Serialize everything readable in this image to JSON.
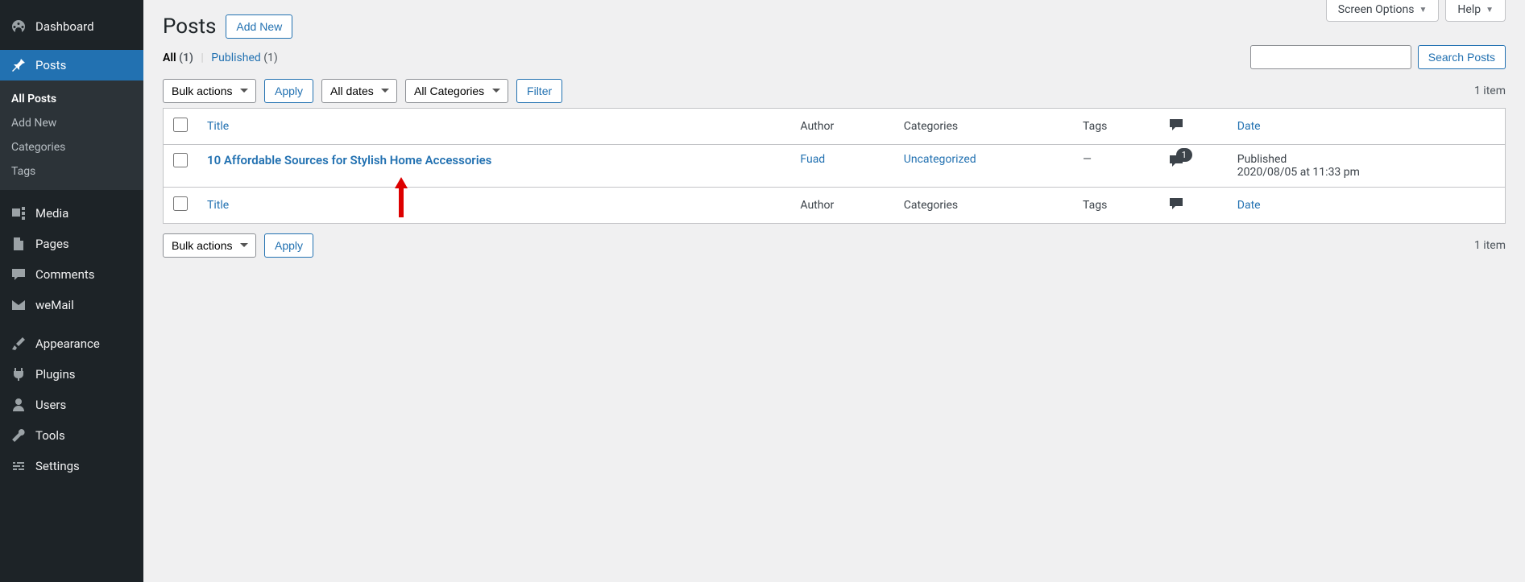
{
  "sidebar": {
    "items": [
      {
        "label": "Dashboard",
        "icon": "gauge"
      },
      {
        "label": "Posts",
        "icon": "pin",
        "active": true
      },
      {
        "label": "Media",
        "icon": "media"
      },
      {
        "label": "Pages",
        "icon": "page"
      },
      {
        "label": "Comments",
        "icon": "comment"
      },
      {
        "label": "weMail",
        "icon": "mail"
      },
      {
        "label": "Appearance",
        "icon": "brush"
      },
      {
        "label": "Plugins",
        "icon": "plug"
      },
      {
        "label": "Users",
        "icon": "user"
      },
      {
        "label": "Tools",
        "icon": "wrench"
      },
      {
        "label": "Settings",
        "icon": "settings"
      }
    ],
    "submenu": [
      {
        "label": "All Posts",
        "current": true
      },
      {
        "label": "Add New"
      },
      {
        "label": "Categories"
      },
      {
        "label": "Tags"
      }
    ]
  },
  "top_tabs": {
    "screen_options": "Screen Options",
    "help": "Help"
  },
  "page": {
    "title": "Posts",
    "add_new": "Add New"
  },
  "filters_links": {
    "all_label": "All",
    "all_count": "(1)",
    "published_label": "Published",
    "published_count": "(1)"
  },
  "search": {
    "button": "Search Posts"
  },
  "filters": {
    "bulk": "Bulk actions",
    "apply": "Apply",
    "dates": "All dates",
    "categories": "All Categories",
    "filter": "Filter"
  },
  "count_label": "1 item",
  "columns": {
    "title": "Title",
    "author": "Author",
    "categories": "Categories",
    "tags": "Tags",
    "date": "Date"
  },
  "rows": [
    {
      "title": "10 Affordable Sources for Stylish Home Accessories",
      "author": "Fuad",
      "category": "Uncategorized",
      "tags": "—",
      "comments": "1",
      "date_status": "Published",
      "date_time": "2020/08/05 at 11:33 pm"
    }
  ]
}
